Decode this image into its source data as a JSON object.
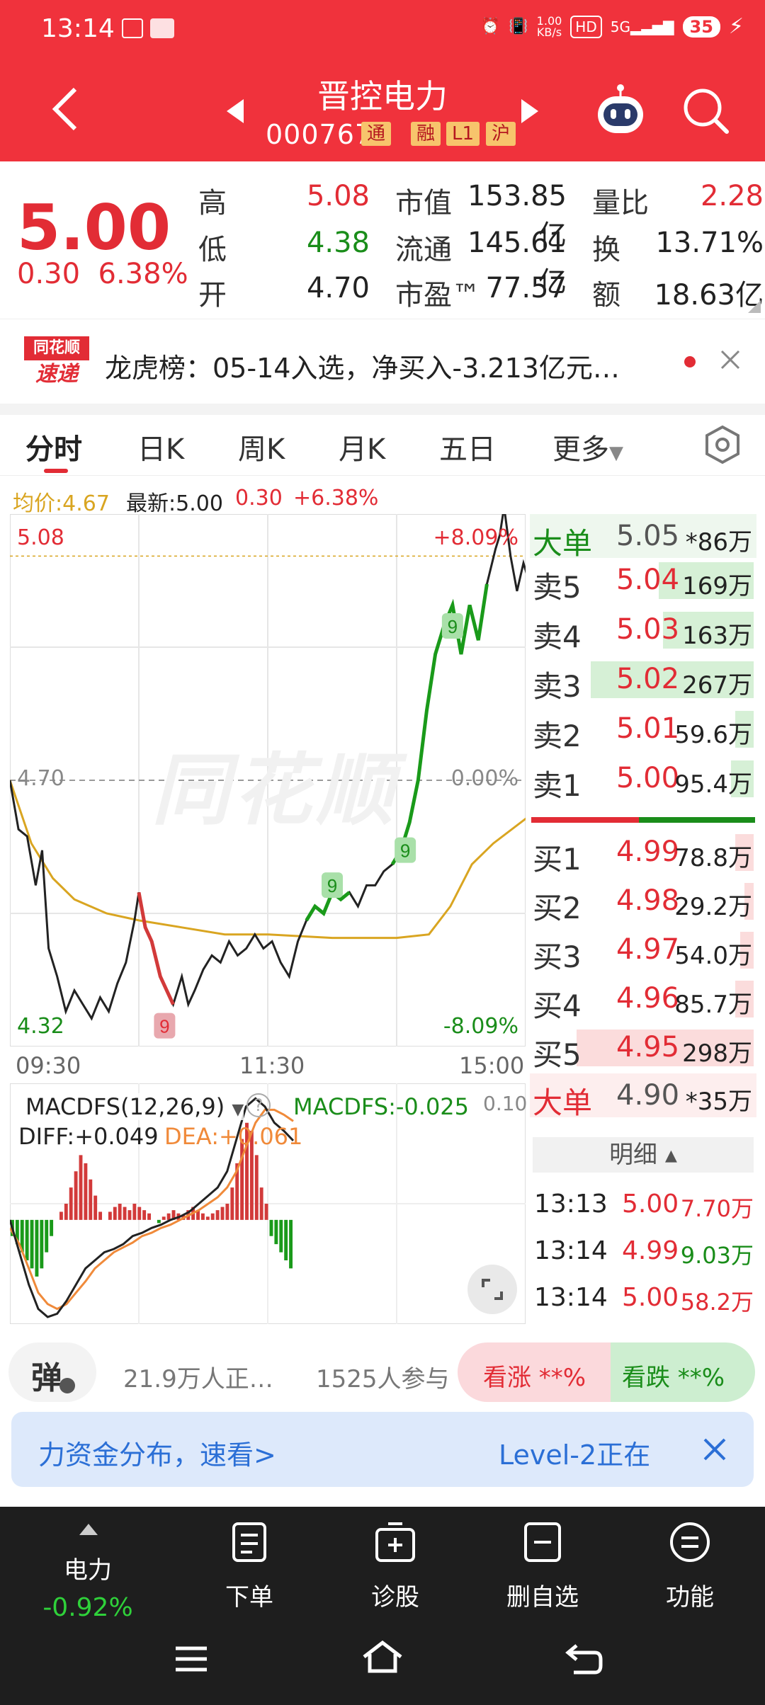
{
  "status": {
    "time": "13:14",
    "net_speed": "1.00",
    "net_unit": "KB/s",
    "hd": "HD",
    "net": "5G",
    "battery": "35"
  },
  "header": {
    "title": "晋控电力",
    "code": "000767",
    "tags": [
      "通",
      "融",
      "L1",
      "沪"
    ]
  },
  "quote": {
    "price": "5.00",
    "change": "0.30",
    "change_pct": "6.38%",
    "high_label": "高",
    "high": "5.08",
    "low_label": "低",
    "low": "4.38",
    "open_label": "开",
    "open": "4.70",
    "mcap_label": "市值",
    "mcap": "153.85亿",
    "float_label": "流通",
    "float": "145.61亿",
    "pe_label": "市盈™",
    "pe": "77.57",
    "vr_label": "量比",
    "vr": "2.28",
    "turnover_label": "换",
    "turnover": "13.71%",
    "amount_label": "额",
    "amount": "18.63亿"
  },
  "news": {
    "logo_top": "同花顺",
    "logo_bottom": "速递",
    "text": "龙虎榜：05-14入选，净买入-3.213亿元…"
  },
  "tabs": [
    "分时",
    "日K",
    "周K",
    "月K",
    "五日",
    "更多"
  ],
  "info": {
    "avg_label": "均价:4.67",
    "latest_label": "最新:5.00",
    "change": "0.30",
    "change_pct": "+6.38%"
  },
  "chart_data": {
    "type": "line",
    "title": "",
    "watermark": "同花顺",
    "ylim": [
      4.32,
      5.08
    ],
    "y_labels": {
      "top": "5.08",
      "mid": "4.70",
      "bottom": "4.32",
      "top_pct": "+8.09%",
      "mid_pct": "0.00%",
      "bottom_pct": "-8.09%"
    },
    "x_labels": [
      "09:30",
      "11:30",
      "15:00"
    ],
    "prev_close": 4.7,
    "ceiling_ref": 5.02,
    "price_series": [
      [
        0,
        4.7
      ],
      [
        4,
        4.63
      ],
      [
        8,
        4.62
      ],
      [
        12,
        4.55
      ],
      [
        15,
        4.6
      ],
      [
        18,
        4.46
      ],
      [
        22,
        4.42
      ],
      [
        26,
        4.37
      ],
      [
        30,
        4.4
      ],
      [
        34,
        4.38
      ],
      [
        38,
        4.36
      ],
      [
        42,
        4.39
      ],
      [
        46,
        4.37
      ],
      [
        50,
        4.41
      ],
      [
        54,
        4.44
      ],
      [
        58,
        4.5
      ],
      [
        60,
        4.54
      ],
      [
        63,
        4.49
      ],
      [
        66,
        4.47
      ],
      [
        70,
        4.42
      ],
      [
        73,
        4.4
      ],
      [
        76,
        4.38
      ],
      [
        80,
        4.42
      ],
      [
        83,
        4.38
      ],
      [
        86,
        4.4
      ],
      [
        90,
        4.43
      ],
      [
        94,
        4.45
      ],
      [
        98,
        4.44
      ],
      [
        102,
        4.47
      ],
      [
        106,
        4.45
      ],
      [
        110,
        4.46
      ],
      [
        114,
        4.48
      ],
      [
        118,
        4.46
      ],
      [
        122,
        4.47
      ],
      [
        126,
        4.44
      ],
      [
        130,
        4.42
      ],
      [
        134,
        4.47
      ],
      [
        138,
        4.5
      ],
      [
        142,
        4.52
      ],
      [
        146,
        4.51
      ],
      [
        150,
        4.54
      ],
      [
        154,
        4.53
      ],
      [
        158,
        4.54
      ],
      [
        162,
        4.52
      ],
      [
        166,
        4.55
      ],
      [
        170,
        4.55
      ],
      [
        174,
        4.57
      ],
      [
        178,
        4.58
      ],
      [
        182,
        4.6
      ],
      [
        186,
        4.64
      ],
      [
        190,
        4.7
      ],
      [
        194,
        4.8
      ],
      [
        198,
        4.88
      ],
      [
        202,
        4.92
      ],
      [
        206,
        4.95
      ],
      [
        210,
        4.88
      ],
      [
        214,
        4.95
      ],
      [
        218,
        4.9
      ],
      [
        222,
        4.98
      ],
      [
        226,
        5.03
      ],
      [
        228,
        5.05
      ],
      [
        230,
        5.09
      ],
      [
        233,
        5.02
      ],
      [
        236,
        4.97
      ],
      [
        239,
        5.01
      ],
      [
        242,
        4.98
      ],
      [
        245,
        4.96
      ],
      [
        248,
        5.0
      ],
      [
        251,
        4.97
      ],
      [
        254,
        5.0
      ],
      [
        257,
        5.0
      ]
    ],
    "avg_series": [
      [
        0,
        4.7
      ],
      [
        10,
        4.61
      ],
      [
        20,
        4.56
      ],
      [
        30,
        4.53
      ],
      [
        45,
        4.51
      ],
      [
        60,
        4.5
      ],
      [
        80,
        4.49
      ],
      [
        100,
        4.48
      ],
      [
        120,
        4.48
      ],
      [
        150,
        4.475
      ],
      [
        180,
        4.475
      ],
      [
        195,
        4.48
      ],
      [
        205,
        4.52
      ],
      [
        215,
        4.58
      ],
      [
        225,
        4.61
      ],
      [
        240,
        4.645
      ],
      [
        257,
        4.67
      ]
    ],
    "markers": [
      {
        "label": "9",
        "color": "#e8a8ae",
        "text": "#e22c35",
        "x": 72,
        "y": 4.38
      },
      {
        "label": "9",
        "color": "#a9e0a9",
        "text": "#1a8d1a",
        "x": 150,
        "y": 4.52
      },
      {
        "label": "9",
        "color": "#a9e0a9",
        "text": "#1a8d1a",
        "x": 184,
        "y": 4.57
      },
      {
        "label": "9",
        "color": "#a9e0a9",
        "text": "#1a8d1a",
        "x": 206,
        "y": 4.89
      }
    ],
    "macd": {
      "label": "MACDFS(12,26,9)",
      "value_label": "MACDFS:-0.025",
      "diff_label": "DIFF:+0.049",
      "dea_label": "DEA:+0.061",
      "top_label": "0.10",
      "ylim": [
        -0.06,
        0.08
      ],
      "hist": [
        -0.01,
        -0.015,
        -0.02,
        -0.025,
        -0.03,
        -0.035,
        -0.03,
        -0.02,
        -0.01,
        0,
        0.005,
        0.01,
        0.02,
        0.03,
        0.04,
        0.035,
        0.025,
        0.015,
        0.005,
        0,
        0.005,
        0.008,
        0.01,
        0.008,
        0.006,
        0.01,
        0.008,
        0.006,
        0.004,
        0,
        -0.002,
        0.002,
        0.004,
        0.006,
        0.004,
        0.003,
        0.006,
        0.008,
        0.006,
        0.004,
        0.002,
        0.004,
        0.006,
        0.008,
        0.01,
        0.02,
        0.035,
        0.05,
        0.06,
        0.055,
        0.04,
        0.02,
        0.01,
        -0.01,
        -0.015,
        -0.02,
        -0.025,
        -0.03
      ],
      "diff": [
        0,
        -0.02,
        -0.04,
        -0.055,
        -0.06,
        -0.058,
        -0.05,
        -0.04,
        -0.03,
        -0.025,
        -0.02,
        -0.018,
        -0.015,
        -0.01,
        -0.008,
        -0.005,
        -0.003,
        0,
        0.002,
        0.005,
        0.01,
        0.015,
        0.02,
        0.03,
        0.05,
        0.07,
        0.075,
        0.07,
        0.06,
        0.055,
        0.049
      ],
      "dea": [
        -0.005,
        -0.015,
        -0.03,
        -0.045,
        -0.052,
        -0.055,
        -0.052,
        -0.045,
        -0.038,
        -0.03,
        -0.025,
        -0.02,
        -0.017,
        -0.014,
        -0.01,
        -0.008,
        -0.005,
        -0.003,
        0,
        0.003,
        0.006,
        0.01,
        0.014,
        0.02,
        0.03,
        0.045,
        0.06,
        0.068,
        0.068,
        0.065,
        0.061
      ]
    }
  },
  "orderbook": {
    "big_sell": {
      "label": "大单",
      "price": "5.05",
      "vol": "*86万"
    },
    "asks": [
      {
        "label": "卖5",
        "price": "5.04",
        "vol": "169万",
        "bar": 0.42
      },
      {
        "label": "卖4",
        "price": "5.03",
        "vol": "163万",
        "bar": 0.4
      },
      {
        "label": "卖3",
        "price": "5.02",
        "vol": "267万",
        "bar": 0.72
      },
      {
        "label": "卖2",
        "price": "5.01",
        "vol": "59.6万",
        "bar": 0.08
      },
      {
        "label": "卖1",
        "price": "5.00",
        "vol": "95.4万",
        "bar": 0.1
      }
    ],
    "bids": [
      {
        "label": "买1",
        "price": "4.99",
        "vol": "78.8万",
        "bar": 0.08
      },
      {
        "label": "买2",
        "price": "4.98",
        "vol": "29.2万",
        "bar": 0.04
      },
      {
        "label": "买3",
        "price": "4.97",
        "vol": "54.0万",
        "bar": 0.06
      },
      {
        "label": "买4",
        "price": "4.96",
        "vol": "85.7万",
        "bar": 0.08
      },
      {
        "label": "买5",
        "price": "4.95",
        "vol": "298万",
        "bar": 0.78
      }
    ],
    "big_buy": {
      "label": "大单",
      "price": "4.90",
      "vol": "*35万"
    },
    "detail_label": "明细 ▴",
    "ticks": [
      {
        "time": "13:13",
        "price": "5.00",
        "vol": "7.70万",
        "vol_color": "#e22c35"
      },
      {
        "time": "13:14",
        "price": "4.99",
        "vol": "9.03万",
        "vol_color": "#1a8d1a"
      },
      {
        "time": "13:14",
        "price": "5.00",
        "vol": "58.2万",
        "vol_color": "#e22c35"
      }
    ]
  },
  "social": {
    "danmu": "弹",
    "viewers": "21.9万人正…",
    "participants": "1525人参与",
    "bull": "看涨 **%",
    "bear": "看跌 **%"
  },
  "banner": {
    "left_text": "力资金分布，速看>",
    "right_text": "Level-2正在"
  },
  "navbar": {
    "sector_label": "电力",
    "sector_change": "-0.92%",
    "items": [
      "下单",
      "诊股",
      "删自选",
      "功能"
    ]
  },
  "colors": {
    "brand_red": "#f0323c",
    "up": "#e22c35",
    "down": "#1a8d1a",
    "avg_line": "#d9a521"
  }
}
